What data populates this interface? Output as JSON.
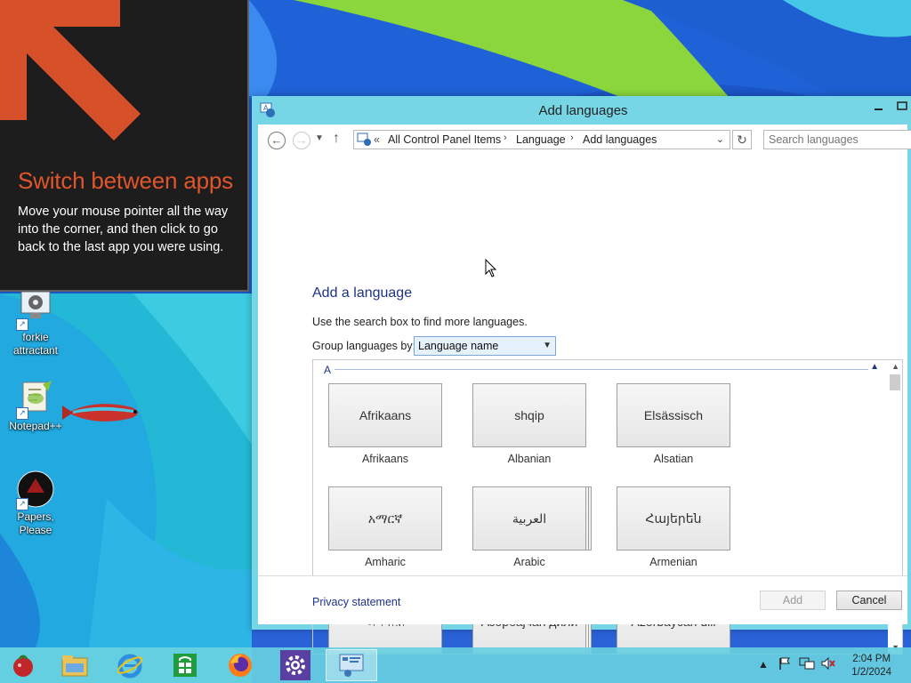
{
  "tip": {
    "title": "Switch between apps",
    "body": "Move your mouse pointer all the way into the corner, and then click to go back to the last app you were using."
  },
  "desktop": {
    "icons": [
      {
        "label": "forkie attractant"
      },
      {
        "label": "Notepad++"
      },
      {
        "label": "Papers, Please"
      }
    ]
  },
  "window": {
    "title": "Add languages",
    "breadcrumb": {
      "overflow": "«",
      "items": [
        "All Control Panel Items",
        "Language",
        "Add languages"
      ],
      "separator": "›"
    },
    "search": {
      "placeholder": "Search languages"
    },
    "heading": "Add a language",
    "hint": "Use the search box to find more languages.",
    "group_label": "Group languages by:",
    "group_value": "Language name",
    "group_header": "A",
    "languages": [
      {
        "native": "Afrikaans",
        "name": "Afrikaans"
      },
      {
        "native": "shqip",
        "name": "Albanian"
      },
      {
        "native": "Elsässisch",
        "name": "Alsatian"
      },
      {
        "native": "አማርኛ",
        "name": "Amharic"
      },
      {
        "native": "العربية",
        "name": "Arabic"
      },
      {
        "native": "Հայերեն",
        "name": "Armenian"
      },
      {
        "native": "অসমীয়া",
        "name": ""
      },
      {
        "native": "Азәрбајҹан дили",
        "name": ""
      },
      {
        "native": "Azərbaycan dili",
        "name": ""
      }
    ],
    "footer": {
      "privacy": "Privacy statement",
      "add": "Add",
      "cancel": "Cancel"
    }
  },
  "taskbar": {
    "apps": [
      "start-orb-icon",
      "file-explorer-icon",
      "internet-explorer-icon",
      "store-icon",
      "firefox-icon",
      "settings-icon",
      "control-panel-icon"
    ],
    "clock": {
      "time": "2:04 PM",
      "date": "1/2/2024"
    }
  },
  "colors": {
    "accent_blue": "#1e3287",
    "tip_orange": "#e0552b",
    "window_frame": "#76d6e5",
    "taskbar": "#69d0e2"
  }
}
